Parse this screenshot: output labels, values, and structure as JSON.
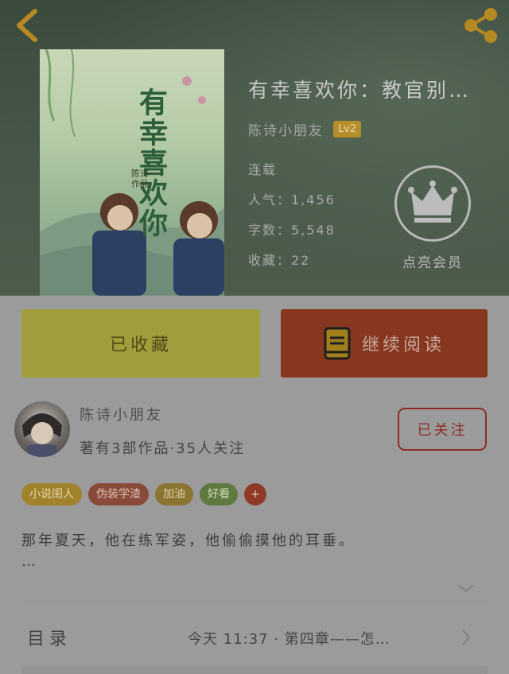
{
  "header": {
    "book_title": "有幸喜欢你：教官别…",
    "author": "陈诗小朋友",
    "level_badge": "Lv2",
    "status": "连载",
    "popularity": "人气：1,456",
    "word_count": "字数：5,548",
    "favorites": "收藏：22",
    "vip_label": "点亮会员"
  },
  "cover": {
    "title_art": "有幸喜欢你",
    "tag_line1": "陈诗",
    "tag_line2": "作品"
  },
  "actions": {
    "collected_label": "已收藏",
    "read_label": "继续阅读"
  },
  "author_card": {
    "name": "陈诗小朋友",
    "meta": "著有3部作品·35人关注",
    "follow_label": "已关注"
  },
  "tags": [
    {
      "label": "小说闺人",
      "bg": "#a0822d",
      "fg": "#e6d6a8"
    },
    {
      "label": "伪装学渣",
      "bg": "#8a4a3a",
      "fg": "#dcc0b4"
    },
    {
      "label": "加油",
      "bg": "#8a7432",
      "fg": "#e0d2a6"
    },
    {
      "label": "好看",
      "bg": "#5f7a40",
      "fg": "#cfdcb8"
    },
    {
      "label": "+",
      "bg": "#8f3a28",
      "fg": "#e6c8bc"
    }
  ],
  "description": "那年夏天，他在练军姿，他偷偷摸他的耳垂。\n…",
  "toc": {
    "label": "目录",
    "latest": "今天 11:37 · 第四章——怎…"
  },
  "icons": {
    "back": "chevron-left-icon",
    "share": "share-icon",
    "vip": "crown-icon",
    "read": "book-icon",
    "expand": "chevron-down-icon",
    "toc_arrow": "chevron-right-icon"
  },
  "colors": {
    "accent_gold": "#b58d2a",
    "collected_bg": "#a09d3c",
    "read_bg": "#87371e",
    "follow_border": "#8a2e24"
  }
}
